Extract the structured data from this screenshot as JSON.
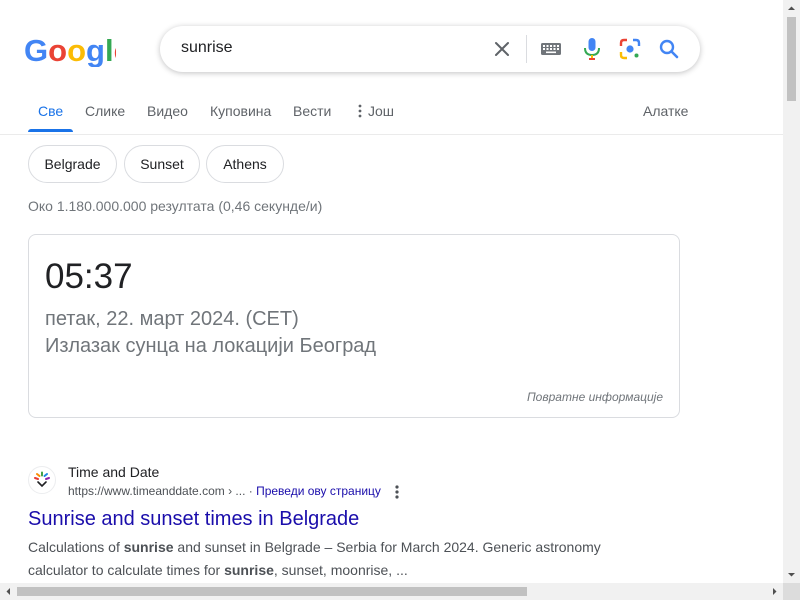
{
  "header": {
    "logo_text": "Google",
    "search_value": "sunrise"
  },
  "tabs": [
    {
      "label": "Све",
      "active": true
    },
    {
      "label": "Слике"
    },
    {
      "label": "Видео"
    },
    {
      "label": "Куповина"
    },
    {
      "label": "Вести"
    },
    {
      "label": "Још"
    }
  ],
  "tools_label": "Алатке",
  "chips": [
    "Belgrade",
    "Sunset",
    "Athens"
  ],
  "result_stats": "Око 1.180.000.000 резултата (0,46 секунде/и)",
  "answer": {
    "time": "05:37",
    "date": "петак, 22. март 2024. (CET)",
    "location_text": "Излазак сунца на локацији Београд",
    "feedback": "Повратне информације"
  },
  "result": {
    "site_name": "Time and Date",
    "url": "https://www.timeanddate.com › ...",
    "separator": " · ",
    "translate": "Преведи ову страницу",
    "title": "Sunrise and sunset times in Belgrade",
    "snippet_parts": [
      {
        "t": "Calculations of ",
        "b": false
      },
      {
        "t": "sunrise",
        "b": true
      },
      {
        "t": " and sunset in Belgrade – Serbia for March 2024. Generic astronomy calculator to calculate times for ",
        "b": false
      },
      {
        "t": "sunrise",
        "b": true
      },
      {
        "t": ", sunset, moonrise, ...",
        "b": false
      }
    ]
  },
  "colors": {
    "link": "#1a0dab",
    "accent": "#1a73e8",
    "muted": "#70757a"
  },
  "icons": [
    "search-icon",
    "microphone-icon",
    "camera-lens-icon",
    "keyboard-icon",
    "clear-icon",
    "more-vert-icon"
  ]
}
